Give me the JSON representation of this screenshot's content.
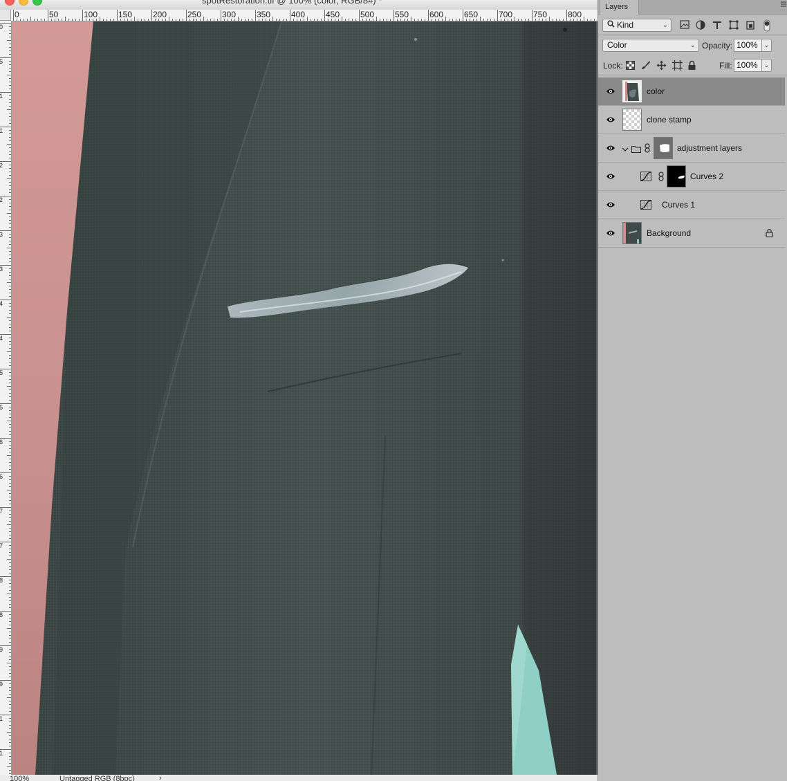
{
  "document": {
    "title": "spotRestoration.tif @ 100% (color, RGB/8#) *",
    "status": {
      "zoom": "100%",
      "doc_info": "Untagged RGB (8bpc)",
      "arrow": "›"
    }
  },
  "rulers": {
    "horizontal": [
      "0",
      "50",
      "100",
      "150",
      "200",
      "250",
      "300",
      "350",
      "400",
      "450",
      "500",
      "550",
      "600",
      "650",
      "700",
      "750",
      "800"
    ],
    "vertical": [
      "0",
      "5",
      "1",
      "1",
      "2",
      "2",
      "3",
      "3",
      "4",
      "4",
      "5",
      "5",
      "6",
      "6",
      "7",
      "7",
      "8",
      "8",
      "9",
      "9",
      "1",
      "1"
    ]
  },
  "colors": {
    "panel_bg": "#bdbdbd",
    "selected_row": "#8a8a8a",
    "jacket": "#3d4746",
    "skin": "#c98f8c",
    "shirt": "#8fcfc6"
  },
  "layers_panel": {
    "tab_label": "Layers",
    "collapse_icon": "panel-menu-icon",
    "filter": {
      "kind_label": "Kind"
    },
    "blend_mode": "Color",
    "opacity_label": "Opacity:",
    "opacity_value": "100%",
    "lock_label": "Lock:",
    "fill_label": "Fill:",
    "fill_value": "100%",
    "layers": [
      {
        "name": "color",
        "selected": true,
        "thumb": "image"
      },
      {
        "name": "clone stamp",
        "thumb": "transparent"
      },
      {
        "name": "adjustment layers",
        "thumb": "group-mask",
        "group": true
      },
      {
        "name": "Curves 2",
        "thumb": "curves-mask",
        "child": true
      },
      {
        "name": "Curves 1",
        "child": true
      },
      {
        "name": "Background",
        "thumb": "image",
        "locked": true
      }
    ]
  }
}
